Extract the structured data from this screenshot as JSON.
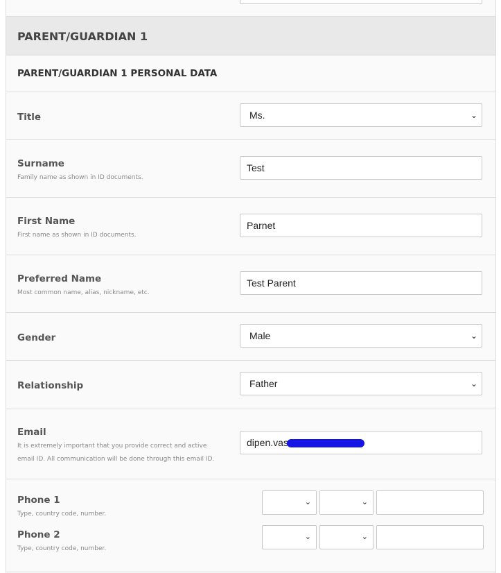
{
  "section": {
    "title": "PARENT/GUARDIAN 1"
  },
  "subsection": {
    "title": "PARENT/GUARDIAN 1 PERSONAL DATA"
  },
  "fields": {
    "title": {
      "label": "Title",
      "value": "Ms."
    },
    "surname": {
      "label": "Surname",
      "hint": "Family name as shown in ID documents.",
      "value": "Test"
    },
    "first_name": {
      "label": "First Name",
      "hint": "First name as shown in ID documents.",
      "value": "Parnet"
    },
    "preferred_name": {
      "label": "Preferred Name",
      "hint": "Most common name, alias, nickname, etc.",
      "value": "Test Parent"
    },
    "gender": {
      "label": "Gender",
      "value": "Male"
    },
    "relationship": {
      "label": "Relationship",
      "value": "Father"
    },
    "email": {
      "label": "Email",
      "hint_line1": "It is extremely important that you provide correct and active",
      "hint_line2": "email ID. All communication will be done through this email ID.",
      "value_visible": "dipen.vas"
    },
    "phone1": {
      "label": "Phone 1",
      "hint": "Type, country code, number."
    },
    "phone2": {
      "label": "Phone 2",
      "hint": "Type, country code, number."
    }
  }
}
